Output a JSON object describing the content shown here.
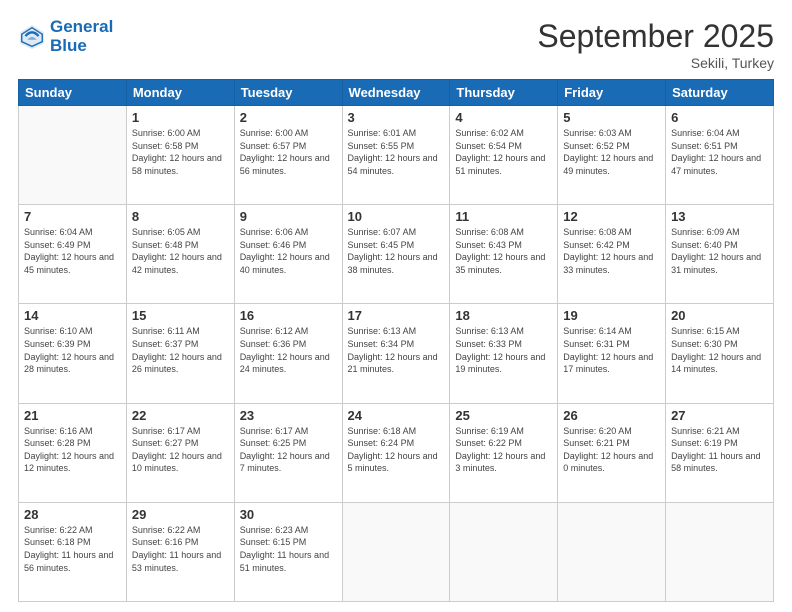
{
  "logo": {
    "line1": "General",
    "line2": "Blue"
  },
  "title": "September 2025",
  "subtitle": "Sekili, Turkey",
  "weekdays": [
    "Sunday",
    "Monday",
    "Tuesday",
    "Wednesday",
    "Thursday",
    "Friday",
    "Saturday"
  ],
  "weeks": [
    [
      {
        "day": "",
        "sunrise": "",
        "sunset": "",
        "daylight": ""
      },
      {
        "day": "1",
        "sunrise": "Sunrise: 6:00 AM",
        "sunset": "Sunset: 6:58 PM",
        "daylight": "Daylight: 12 hours and 58 minutes."
      },
      {
        "day": "2",
        "sunrise": "Sunrise: 6:00 AM",
        "sunset": "Sunset: 6:57 PM",
        "daylight": "Daylight: 12 hours and 56 minutes."
      },
      {
        "day": "3",
        "sunrise": "Sunrise: 6:01 AM",
        "sunset": "Sunset: 6:55 PM",
        "daylight": "Daylight: 12 hours and 54 minutes."
      },
      {
        "day": "4",
        "sunrise": "Sunrise: 6:02 AM",
        "sunset": "Sunset: 6:54 PM",
        "daylight": "Daylight: 12 hours and 51 minutes."
      },
      {
        "day": "5",
        "sunrise": "Sunrise: 6:03 AM",
        "sunset": "Sunset: 6:52 PM",
        "daylight": "Daylight: 12 hours and 49 minutes."
      },
      {
        "day": "6",
        "sunrise": "Sunrise: 6:04 AM",
        "sunset": "Sunset: 6:51 PM",
        "daylight": "Daylight: 12 hours and 47 minutes."
      }
    ],
    [
      {
        "day": "7",
        "sunrise": "Sunrise: 6:04 AM",
        "sunset": "Sunset: 6:49 PM",
        "daylight": "Daylight: 12 hours and 45 minutes."
      },
      {
        "day": "8",
        "sunrise": "Sunrise: 6:05 AM",
        "sunset": "Sunset: 6:48 PM",
        "daylight": "Daylight: 12 hours and 42 minutes."
      },
      {
        "day": "9",
        "sunrise": "Sunrise: 6:06 AM",
        "sunset": "Sunset: 6:46 PM",
        "daylight": "Daylight: 12 hours and 40 minutes."
      },
      {
        "day": "10",
        "sunrise": "Sunrise: 6:07 AM",
        "sunset": "Sunset: 6:45 PM",
        "daylight": "Daylight: 12 hours and 38 minutes."
      },
      {
        "day": "11",
        "sunrise": "Sunrise: 6:08 AM",
        "sunset": "Sunset: 6:43 PM",
        "daylight": "Daylight: 12 hours and 35 minutes."
      },
      {
        "day": "12",
        "sunrise": "Sunrise: 6:08 AM",
        "sunset": "Sunset: 6:42 PM",
        "daylight": "Daylight: 12 hours and 33 minutes."
      },
      {
        "day": "13",
        "sunrise": "Sunrise: 6:09 AM",
        "sunset": "Sunset: 6:40 PM",
        "daylight": "Daylight: 12 hours and 31 minutes."
      }
    ],
    [
      {
        "day": "14",
        "sunrise": "Sunrise: 6:10 AM",
        "sunset": "Sunset: 6:39 PM",
        "daylight": "Daylight: 12 hours and 28 minutes."
      },
      {
        "day": "15",
        "sunrise": "Sunrise: 6:11 AM",
        "sunset": "Sunset: 6:37 PM",
        "daylight": "Daylight: 12 hours and 26 minutes."
      },
      {
        "day": "16",
        "sunrise": "Sunrise: 6:12 AM",
        "sunset": "Sunset: 6:36 PM",
        "daylight": "Daylight: 12 hours and 24 minutes."
      },
      {
        "day": "17",
        "sunrise": "Sunrise: 6:13 AM",
        "sunset": "Sunset: 6:34 PM",
        "daylight": "Daylight: 12 hours and 21 minutes."
      },
      {
        "day": "18",
        "sunrise": "Sunrise: 6:13 AM",
        "sunset": "Sunset: 6:33 PM",
        "daylight": "Daylight: 12 hours and 19 minutes."
      },
      {
        "day": "19",
        "sunrise": "Sunrise: 6:14 AM",
        "sunset": "Sunset: 6:31 PM",
        "daylight": "Daylight: 12 hours and 17 minutes."
      },
      {
        "day": "20",
        "sunrise": "Sunrise: 6:15 AM",
        "sunset": "Sunset: 6:30 PM",
        "daylight": "Daylight: 12 hours and 14 minutes."
      }
    ],
    [
      {
        "day": "21",
        "sunrise": "Sunrise: 6:16 AM",
        "sunset": "Sunset: 6:28 PM",
        "daylight": "Daylight: 12 hours and 12 minutes."
      },
      {
        "day": "22",
        "sunrise": "Sunrise: 6:17 AM",
        "sunset": "Sunset: 6:27 PM",
        "daylight": "Daylight: 12 hours and 10 minutes."
      },
      {
        "day": "23",
        "sunrise": "Sunrise: 6:17 AM",
        "sunset": "Sunset: 6:25 PM",
        "daylight": "Daylight: 12 hours and 7 minutes."
      },
      {
        "day": "24",
        "sunrise": "Sunrise: 6:18 AM",
        "sunset": "Sunset: 6:24 PM",
        "daylight": "Daylight: 12 hours and 5 minutes."
      },
      {
        "day": "25",
        "sunrise": "Sunrise: 6:19 AM",
        "sunset": "Sunset: 6:22 PM",
        "daylight": "Daylight: 12 hours and 3 minutes."
      },
      {
        "day": "26",
        "sunrise": "Sunrise: 6:20 AM",
        "sunset": "Sunset: 6:21 PM",
        "daylight": "Daylight: 12 hours and 0 minutes."
      },
      {
        "day": "27",
        "sunrise": "Sunrise: 6:21 AM",
        "sunset": "Sunset: 6:19 PM",
        "daylight": "Daylight: 11 hours and 58 minutes."
      }
    ],
    [
      {
        "day": "28",
        "sunrise": "Sunrise: 6:22 AM",
        "sunset": "Sunset: 6:18 PM",
        "daylight": "Daylight: 11 hours and 56 minutes."
      },
      {
        "day": "29",
        "sunrise": "Sunrise: 6:22 AM",
        "sunset": "Sunset: 6:16 PM",
        "daylight": "Daylight: 11 hours and 53 minutes."
      },
      {
        "day": "30",
        "sunrise": "Sunrise: 6:23 AM",
        "sunset": "Sunset: 6:15 PM",
        "daylight": "Daylight: 11 hours and 51 minutes."
      },
      {
        "day": "",
        "sunrise": "",
        "sunset": "",
        "daylight": ""
      },
      {
        "day": "",
        "sunrise": "",
        "sunset": "",
        "daylight": ""
      },
      {
        "day": "",
        "sunrise": "",
        "sunset": "",
        "daylight": ""
      },
      {
        "day": "",
        "sunrise": "",
        "sunset": "",
        "daylight": ""
      }
    ]
  ]
}
